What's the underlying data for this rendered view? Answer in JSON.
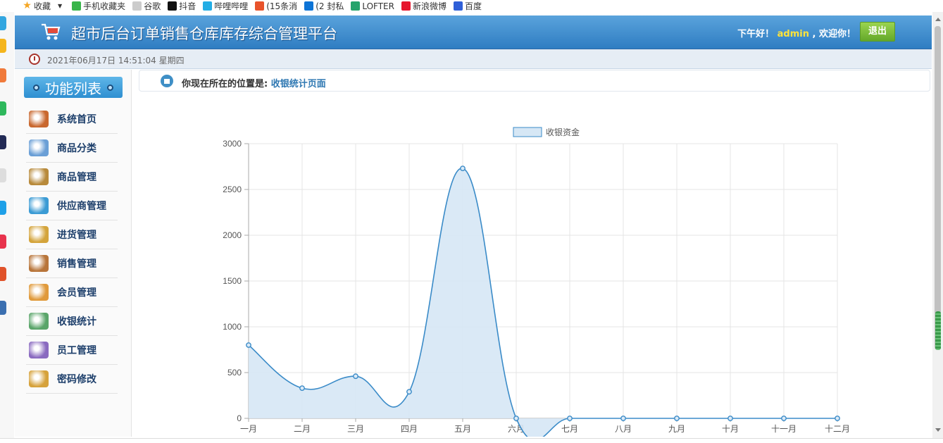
{
  "bookmarks": [
    {
      "label": "收藏",
      "icon": "star-icon"
    },
    {
      "label": "手机收藏夹",
      "icon": "phone-icon"
    },
    {
      "label": "谷歌",
      "icon": "page-icon"
    },
    {
      "label": "抖音",
      "icon": "douyin-icon"
    },
    {
      "label": "哔哩哔哩",
      "icon": "bilibili-icon"
    },
    {
      "label": "(15条消",
      "icon": "csdn-icon"
    },
    {
      "label": "(2 封私",
      "icon": "zhihu-icon"
    },
    {
      "label": "LOFTER",
      "icon": "lofter-icon"
    },
    {
      "label": "新浪微博",
      "icon": "weibo-icon"
    },
    {
      "label": "百度",
      "icon": "baidu-icon"
    }
  ],
  "header": {
    "title": "超市后台订单销售仓库库存综合管理平台",
    "greeting_prefix": "下午好！",
    "username": "admin",
    "greeting_suffix": ", 欢迎你！",
    "logout_label": "退出"
  },
  "datebar": {
    "datetime": "2021年06月17日 14:51:04 星期四"
  },
  "menu": {
    "title": "功能列表",
    "items": [
      {
        "label": "系统首页",
        "icon": "house-icon"
      },
      {
        "label": "商品分类",
        "icon": "category-icon"
      },
      {
        "label": "商品管理",
        "icon": "cart-goods-icon"
      },
      {
        "label": "供应商管理",
        "icon": "supplier-icon"
      },
      {
        "label": "进货管理",
        "icon": "purchase-icon"
      },
      {
        "label": "销售管理",
        "icon": "sales-box-icon"
      },
      {
        "label": "会员管理",
        "icon": "members-icon"
      },
      {
        "label": "收银统计",
        "icon": "cash-icon"
      },
      {
        "label": "员工管理",
        "icon": "staff-icon"
      },
      {
        "label": "密码修改",
        "icon": "password-icon"
      }
    ]
  },
  "breadcrumb": {
    "prefix": "你现在所在的位置是:",
    "location": "收银统计页面"
  },
  "colors": {
    "header_top": "#5aa3dc",
    "header_bottom": "#2f7dc2",
    "logout_green": "#7cc23a",
    "username_yellow": "#ffe33a",
    "line": "#3a8bc8",
    "fill": "#d6e7f5"
  },
  "chart_data": {
    "type": "area",
    "title": "",
    "xlabel": "",
    "ylabel": "",
    "categories": [
      "一月",
      "二月",
      "三月",
      "四月",
      "五月",
      "六月",
      "七月",
      "八月",
      "九月",
      "十月",
      "十一月",
      "十二月"
    ],
    "series": [
      {
        "name": "收银资金",
        "values": [
          800,
          330,
          460,
          290,
          2730,
          0,
          0,
          0,
          0,
          0,
          0,
          0
        ]
      }
    ],
    "yticks": [
      "0",
      "500",
      "1000",
      "1500",
      "2000",
      "2500",
      "3000"
    ],
    "ylim": [
      0,
      3000
    ],
    "grid": true,
    "legend": "top-center",
    "curve": "smooth"
  }
}
